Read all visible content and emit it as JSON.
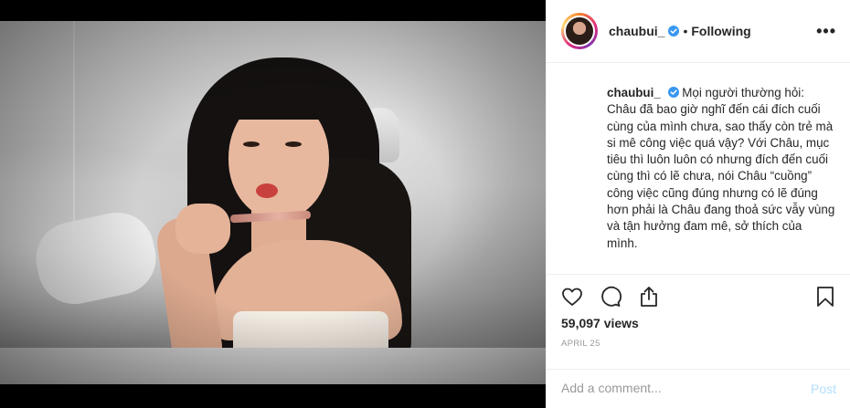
{
  "header": {
    "username": "chaubui_",
    "separator": "•",
    "follow_status": "Following",
    "more_label": "•••"
  },
  "caption": {
    "username": "chaubui_",
    "text": "Mọi người thường hỏi: Châu đã bao giờ nghĩ đến cái đích cuối cùng của mình chưa, sao thấy còn trẻ mà si mê công việc quá vậy? Với Châu, mục tiêu thì luôn luôn có nhưng đích đến cuối cùng thì có lẽ chưa, nói Châu “cuồng” công việc cũng đúng nhưng có lẽ đúng hơn phải là Châu đang thoả sức vẫy vùng và tận hưởng đam mê, sở thích của mình."
  },
  "stats": {
    "views": "59,097 views",
    "date": "APRIL 25"
  },
  "comment": {
    "placeholder": "Add a comment...",
    "post_label": "Post"
  },
  "icons": {
    "like": "heart-icon",
    "comment": "comment-icon",
    "share": "share-icon",
    "save": "bookmark-icon",
    "verified": "verified-badge-icon"
  },
  "colors": {
    "verified": "#3897f0",
    "post_disabled": "#b2dffc",
    "muted": "#999999"
  }
}
